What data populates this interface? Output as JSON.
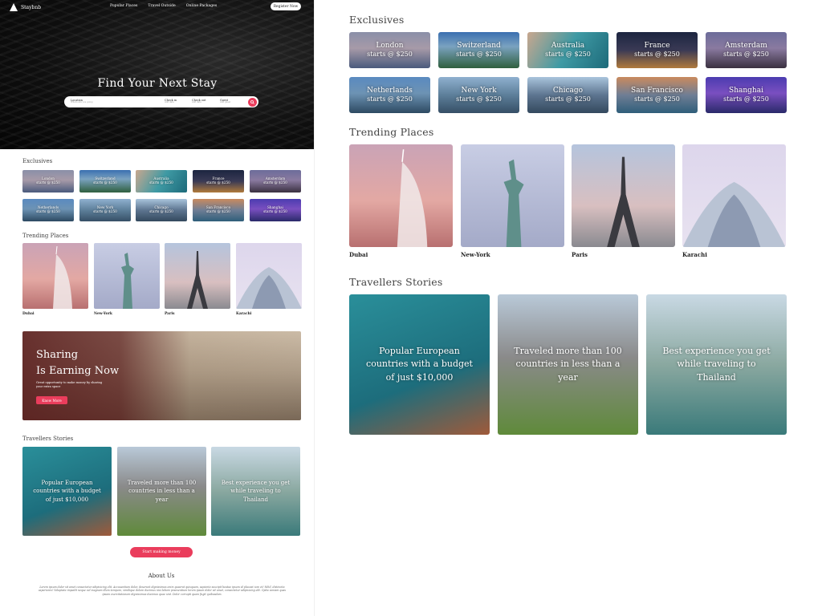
{
  "nav": {
    "brand": "Staybnb",
    "links": [
      "Popular Places",
      "Travel Outside",
      "Online Packages"
    ],
    "register": "Register Now"
  },
  "hero": {
    "title": "Find Your Next Stay",
    "search": {
      "location_label": "Location",
      "location_hint": "Where are you going",
      "checkin_label": "Check in",
      "checkin_hint": "Add date",
      "checkout_label": "Check out",
      "checkout_hint": "Add date",
      "guest_label": "Guest",
      "guest_hint": "Add guest"
    }
  },
  "sections": {
    "exclusives": "Exclusives",
    "trending": "Trending Places",
    "stories": "Travellers Stories"
  },
  "exclusives": [
    {
      "name": "London",
      "price": "starts @ $250"
    },
    {
      "name": "Switzerland",
      "price": "starts @ $250"
    },
    {
      "name": "Australia",
      "price": "starts @ $250"
    },
    {
      "name": "France",
      "price": "starts @ $250"
    },
    {
      "name": "Amsterdam",
      "price": "starts @ $250"
    },
    {
      "name": "Netherlands",
      "price": "starts @ $250"
    },
    {
      "name": "New York",
      "price": "starts @ $250"
    },
    {
      "name": "Chicago",
      "price": "starts @ $250"
    },
    {
      "name": "San Francisco",
      "price": "starts @ $250"
    },
    {
      "name": "Shanghai",
      "price": "starts @ $250"
    }
  ],
  "trending": [
    "Dubai",
    "New-York",
    "Paris",
    "Karachi"
  ],
  "banner": {
    "title_line1": "Sharing",
    "title_line2": "Is Earning Now",
    "subtitle": "Great opportunity to make money by sharing your extra space",
    "button": "Know More"
  },
  "stories": [
    "Popular European countries with a budget of just $10,000",
    "Traveled more than 100 countries in less than a year",
    "Best experience you get while traveling to Thailand"
  ],
  "cta": "Start making money",
  "about": {
    "title": "About Us",
    "text": "Lorem ipsum dolor sit amet consectetur adipisicing elit. Accusantium dolor, deserunt dignissimos enim quaerat quisquam, sapiente suscipit beatae ipsum id placeat iure et! Nihil, distinctio asperiores! Voluptate impedit neque vel magnam illum tempore, similique dolore ducimus nisi labore praesentium lorem ipsum dolor sit amet, consectetur adipisicing elit. Optio veniam quas ipsam exercitationem dignissimos ducimus quae sint. Dolor corrupti quam fugit quibusdam."
  },
  "colors": {
    "accent": "#ea3d5c",
    "hero_bg": "#0e0e0e"
  }
}
